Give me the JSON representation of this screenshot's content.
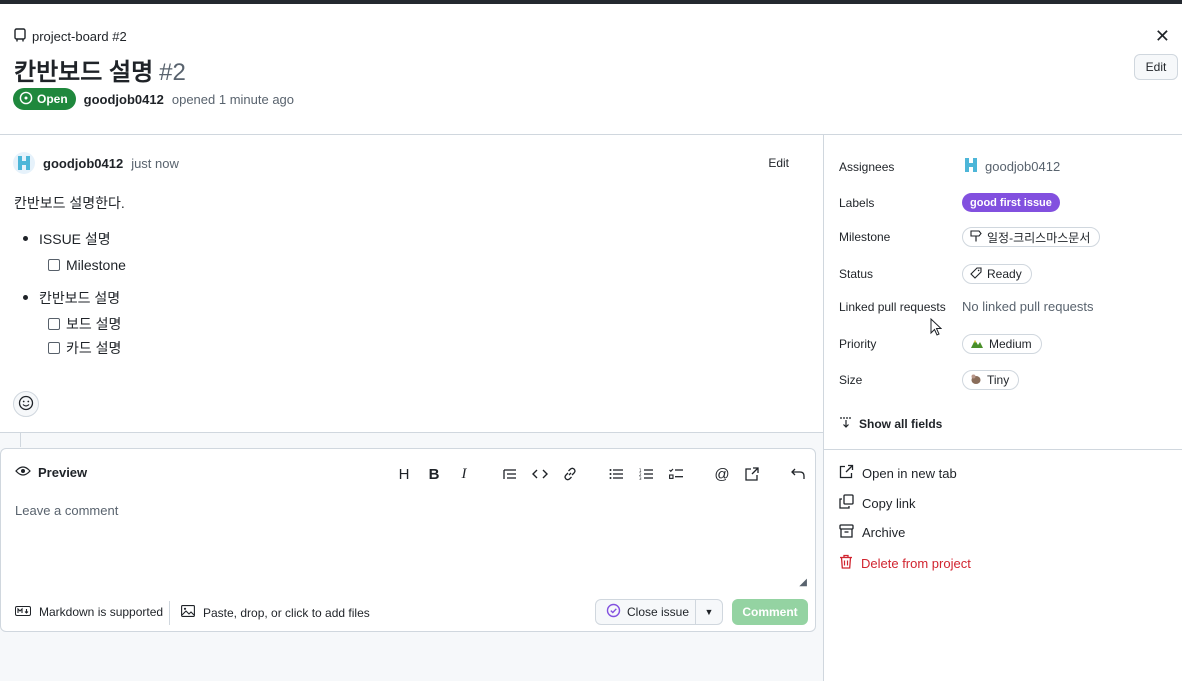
{
  "header": {
    "breadcrumb": "project-board #2",
    "title": "칸반보드 설명",
    "number": "#2",
    "edit_label": "Edit",
    "status": "Open",
    "author": "goodjob0412",
    "opened_text": "opened 1 minute ago"
  },
  "comment": {
    "author": "goodjob0412",
    "time": "just now",
    "edit_label": "Edit",
    "intro": "칸반보드 설명한다.",
    "items": [
      {
        "label": "ISSUE 설명",
        "tasks": [
          "Milestone"
        ]
      },
      {
        "label": "칸반보드 설명",
        "tasks": [
          "보드 설명",
          "카드 설명"
        ]
      }
    ]
  },
  "editor": {
    "tab_label": "Preview",
    "placeholder": "Leave a comment",
    "markdown_note": "Markdown is supported",
    "files_note": "Paste, drop, or click to add files",
    "close_issue_label": "Close issue",
    "comment_label": "Comment",
    "toolbar": [
      "heading-icon",
      "bold-icon",
      "italic-icon",
      "quote-icon",
      "code-icon",
      "link-icon",
      "unordered-list-icon",
      "ordered-list-icon",
      "task-list-icon",
      "mention-icon",
      "reference-icon",
      "undo-icon"
    ]
  },
  "sidebar": {
    "assignees_label": "Assignees",
    "assignee": "goodjob0412",
    "labels_label": "Labels",
    "label_value": "good first issue",
    "milestone_label": "Milestone",
    "milestone_value": "일정-크리스마스문서",
    "status_label": "Status",
    "status_value": "Ready",
    "linked_label": "Linked pull requests",
    "linked_value": "No linked pull requests",
    "priority_label": "Priority",
    "priority_value": "Medium",
    "size_label": "Size",
    "size_value": "Tiny",
    "show_all": "Show all fields",
    "actions": {
      "open_new_tab": "Open in new tab",
      "copy_link": "Copy link",
      "archive": "Archive",
      "delete": "Delete from project"
    }
  },
  "colors": {
    "open_green": "#1f883d",
    "label_purple": "#8250df",
    "danger_red": "#d1242f",
    "comment_btn_disabled": "#94d3a2"
  }
}
